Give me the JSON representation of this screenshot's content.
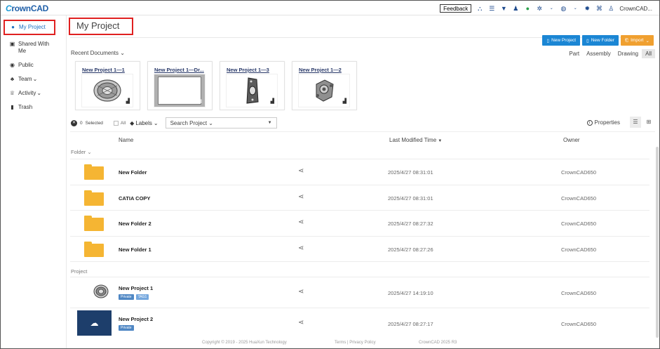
{
  "app": {
    "logo_prefix": "C",
    "logo_rest": "rownCAD"
  },
  "topbar": {
    "feedback_label": "Feedback",
    "icons": [
      "share-network-icon",
      "list-icon",
      "filter-icon",
      "users-icon",
      "wechat-icon",
      "settings-icon",
      "globe-icon",
      "gear-icon",
      "apps-icon",
      "user-icon"
    ],
    "user_name": "CrownCAD..."
  },
  "sidebar": {
    "items": [
      {
        "label": "My Project",
        "icon": "user-icon",
        "active": true
      },
      {
        "label": "Shared With Me",
        "icon": "shared-icon"
      },
      {
        "label": "Public",
        "icon": "globe-icon"
      },
      {
        "label": "Team",
        "icon": "team-icon",
        "caret": "⌄"
      },
      {
        "label": "Activity",
        "icon": "trophy-icon",
        "caret": "⌄"
      },
      {
        "label": "Trash",
        "icon": "trash-icon"
      }
    ]
  },
  "main": {
    "page_title": "My Project",
    "actions": {
      "new_project": "New Project",
      "new_folder": "New Folder",
      "import": "Import"
    },
    "recent_label": "Recent Documents",
    "filters": [
      "Part",
      "Assembly",
      "Drawing",
      "All"
    ],
    "active_filter": "All",
    "recent": [
      {
        "title": "New Project 1—1",
        "kind": "wheel"
      },
      {
        "title": "New Project 1—Dr...",
        "kind": "drawing"
      },
      {
        "title": "New Project 1—3",
        "kind": "plate"
      },
      {
        "title": "New Project 1—2",
        "kind": "housing"
      }
    ],
    "toolbar": {
      "selected_count": "0",
      "selected_label": "Selected",
      "all_label": "All",
      "labels_label": "Labels",
      "search_project": "Search Project",
      "properties_label": "Properties"
    },
    "columns": {
      "name": "Name",
      "modified": "Last Modified Time",
      "owner": "Owner"
    },
    "folder_group_label": "Folder",
    "project_group_label": "Project",
    "folders": [
      {
        "name": "New Folder",
        "modified": "2025/4/27 08:31:01",
        "owner": "CrownCAD650"
      },
      {
        "name": "CATIA COPY",
        "modified": "2025/4/27 08:31:01",
        "owner": "CrownCAD650"
      },
      {
        "name": "New Folder 2",
        "modified": "2025/4/27 08:27:32",
        "owner": "CrownCAD650"
      },
      {
        "name": "New Folder 1",
        "modified": "2025/4/27 08:27:26",
        "owner": "CrownCAD650"
      }
    ],
    "projects": [
      {
        "name": "New Project 1",
        "tags": [
          "Private",
          "TAG1"
        ],
        "modified": "2025/4/27 14:19:10",
        "owner": "CrownCAD650",
        "kind": "wheel"
      },
      {
        "name": "New Project 2",
        "tags": [
          "Private"
        ],
        "modified": "2025/4/27 08:27:17",
        "owner": "CrownCAD650",
        "kind": "cloud"
      }
    ]
  },
  "footer": {
    "copyright": "Copyright © 2019 - 2025 HuaXun Technology",
    "links": "Terms | Privacy Policy",
    "version": "CrownCAD 2025 R3"
  }
}
